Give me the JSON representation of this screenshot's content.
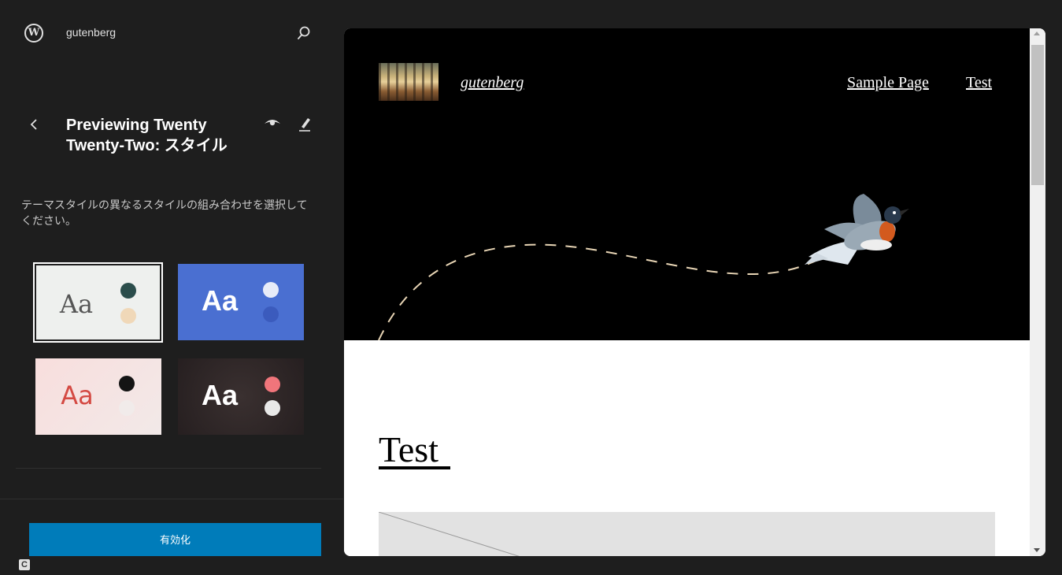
{
  "sidebar": {
    "site_name": "gutenberg",
    "title": "Previewing Twenty Twenty-Two: スタイル",
    "description": "テーマスタイルの異なるスタイルの組み合わせを選択してください。",
    "variations": [
      {
        "label": "Aa",
        "colors": [
          "#2b4d4b",
          "#f0d8b8"
        ],
        "background": "#eef0ee",
        "text_color": "#555555",
        "selected": true
      },
      {
        "label": "Aa",
        "colors": [
          "#e8ecf8",
          "#3b5bbd"
        ],
        "background": "#4a6fd1",
        "text_color": "#ffffff",
        "selected": false
      },
      {
        "label": "Aa",
        "colors": [
          "#141414",
          "#f1ebea"
        ],
        "background": "#f8dedd",
        "text_color": "#d44a43",
        "selected": false
      },
      {
        "label": "Aa",
        "colors": [
          "#f0757b",
          "#e8e8e8"
        ],
        "background": "#2e2627",
        "text_color": "#ffffff",
        "selected": false
      }
    ],
    "activate_label": "有効化",
    "badge": "C"
  },
  "preview": {
    "site_title": "gutenberg",
    "nav": [
      "Sample Page",
      "Test"
    ],
    "post_title": "Test"
  },
  "colors": {
    "accent": "#007cba",
    "sidebar_bg": "#1e1e1e"
  }
}
